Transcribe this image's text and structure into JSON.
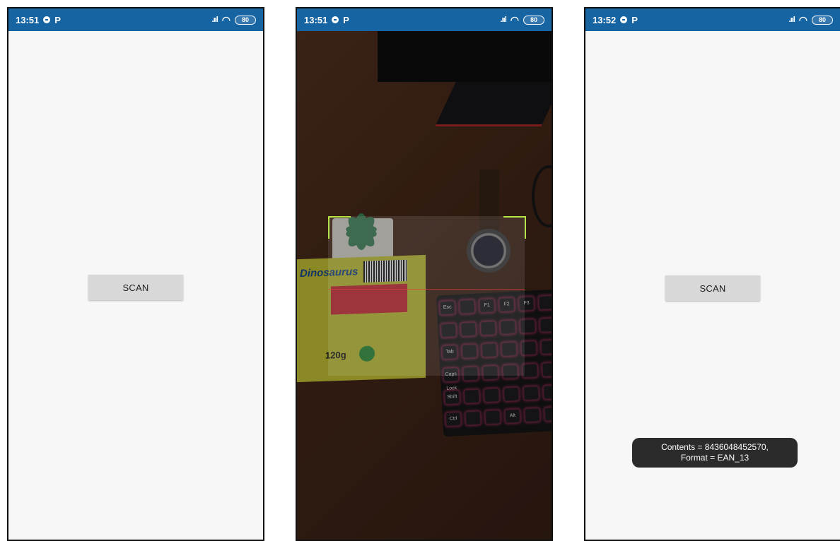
{
  "screens": [
    {
      "status_bar": {
        "time": "13:51",
        "battery": "80"
      },
      "scan_button": "SCAN"
    },
    {
      "status_bar": {
        "time": "13:51",
        "battery": "80"
      },
      "box_brand_text": "Dinosaurus",
      "box_weight_text": "120g",
      "keyboard_keys": [
        "Esc",
        "F1",
        "F2",
        "F3",
        "Tab",
        "Caps Lock",
        "Shift",
        "Ctrl",
        "Alt"
      ]
    },
    {
      "status_bar": {
        "time": "13:52",
        "battery": "80"
      },
      "scan_button": "SCAN",
      "toast": {
        "line1": "Contents = 8436048452570,",
        "line2": "Format = EAN_13"
      }
    }
  ],
  "colors": {
    "status_bar": "#1764a3",
    "app_background": "#f7f7f7",
    "button": "#d8d8d8",
    "toast": "#2b2b2b",
    "scanner_corner": "#b7e34a"
  }
}
